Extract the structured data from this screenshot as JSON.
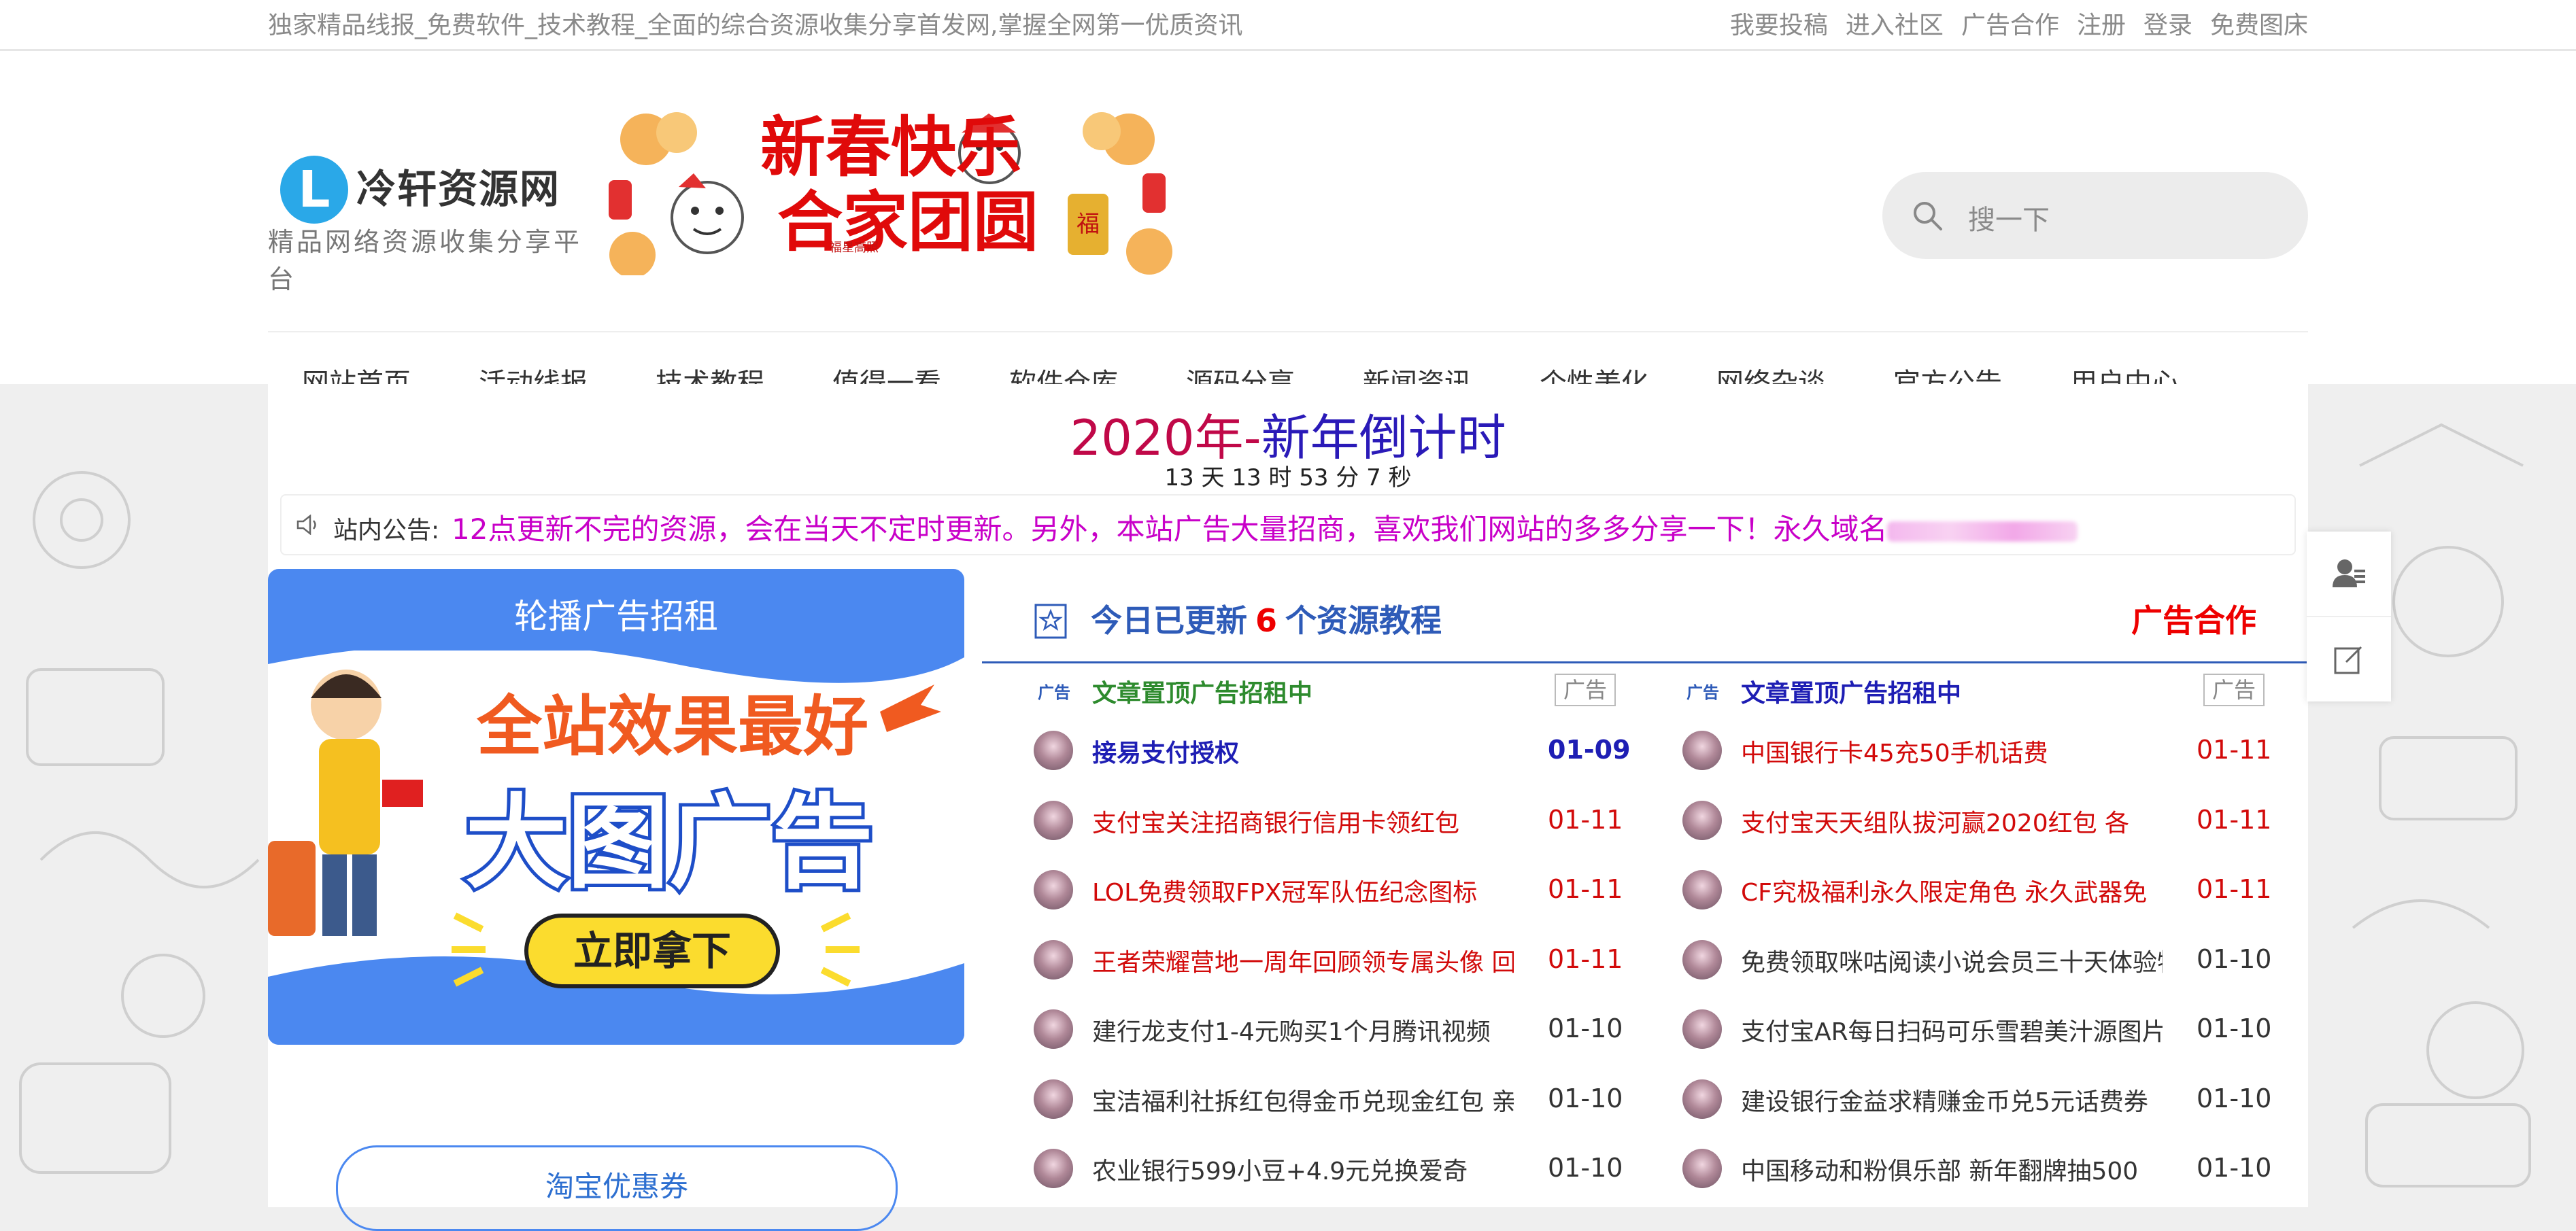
{
  "topbar": {
    "slogan": "独家精品线报_免费软件_技术教程_全面的综合资源收集分享首发网,掌握全网第一优质资讯",
    "links": [
      "我要投稿",
      "进入社区",
      "广告合作",
      "注册",
      "登录",
      "免费图床"
    ]
  },
  "logo": {
    "letter": "L",
    "name": "冷轩资源网",
    "sub": "精品网络资源收集分享平台"
  },
  "banner": {
    "text1": "新春快乐",
    "text2": "合家团圆",
    "stamp": "福",
    "small": "福星高照"
  },
  "search": {
    "placeholder": "搜一下",
    "icon": "search-icon"
  },
  "nav": [
    "网站首页",
    "活动线报",
    "技术教程",
    "值得一看",
    "软件仓库",
    "源码分享",
    "新闻资讯",
    "个性美化",
    "网络杂谈",
    "官方公告",
    "用户中心"
  ],
  "countdown": {
    "year": "2020",
    "part1": "年-",
    "part2": "新年倒计时",
    "time": "13 天 13 时 53 分 7 秒"
  },
  "notice": {
    "label": "站内公告:",
    "text": "12点更新不完的资源，会在当天不定时更新。另外，本站广告大量招商，喜欢我们网站的多多分享一下！永久域名"
  },
  "adcard": {
    "title": "轮播广告招租",
    "line1": "全站效果最好",
    "line2": "大图广告",
    "button": "立即拿下"
  },
  "taobao": "淘宝优惠券",
  "panel": {
    "prefix": "今日已更新",
    "count": "6",
    "suffix": "个资源教程",
    "ad_link": "广告合作",
    "ad_tag": "广告",
    "ad_box": "广告",
    "left_top": "文章置顶广告招租中",
    "right_top": "文章置顶广告招租中",
    "left": [
      {
        "title": "接易支付授权",
        "date": "01-09"
      },
      {
        "title": "支付宝关注招商银行信用卡领红包",
        "date": "01-11"
      },
      {
        "title": "LOL免费领取FPX冠军队伍纪念图标",
        "date": "01-11"
      },
      {
        "title": "王者荣耀营地一周年回顾领专属头像 回",
        "date": "01-11"
      },
      {
        "title": "建行龙支付1-4元购买1个月腾讯视频",
        "date": "01-10"
      },
      {
        "title": "宝洁福利社拆红包得金币兑现金红包 亲",
        "date": "01-10"
      },
      {
        "title": "农业银行599小豆+4.9元兑换爱奇",
        "date": "01-10"
      }
    ],
    "right": [
      {
        "title": "中国银行卡45充50手机话费",
        "date": "01-11"
      },
      {
        "title": "支付宝天天组队拔河赢2020红包 各",
        "date": "01-11"
      },
      {
        "title": "CF究极福利永久限定角色 永久武器免",
        "date": "01-11"
      },
      {
        "title": "免费领取咪咕阅读小说会员三十天体验特",
        "date": "01-10"
      },
      {
        "title": "支付宝AR每日扫码可乐雪碧美汁源图片",
        "date": "01-10"
      },
      {
        "title": "建设银行金益求精赚金币兑5元话费券",
        "date": "01-10"
      },
      {
        "title": "中国移动和粉俱乐部 新年翻牌抽500",
        "date": "01-10"
      }
    ]
  },
  "float_buttons": [
    "user-service-icon",
    "edit-icon"
  ]
}
